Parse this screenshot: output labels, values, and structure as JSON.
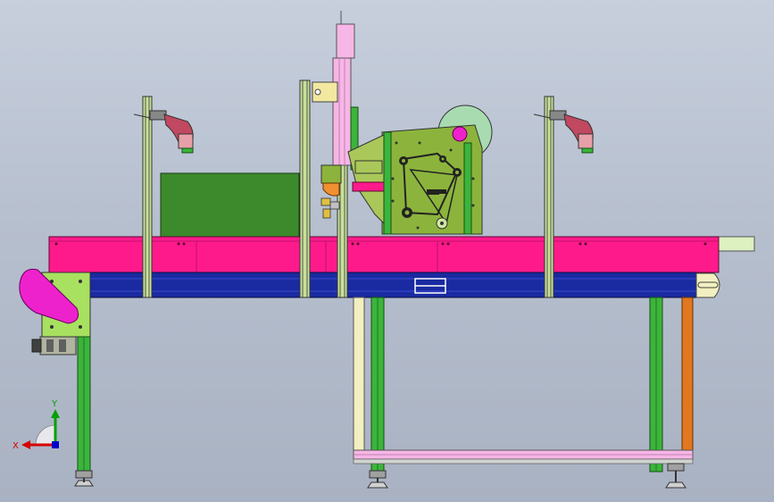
{
  "view": {
    "background_top": "#c7cfdd",
    "background_bottom": "#a9b2c2"
  },
  "triad": {
    "x_label": "X",
    "y_label": "Y",
    "x_color": "#d40000",
    "y_color": "#00a000",
    "z_color": "#0000c8"
  },
  "colors": {
    "conveyor_top": "#ff1a8c",
    "conveyor_belt": "#1a2aa0",
    "legs_green": "#3cb43c",
    "frame_pink": "#f6b6e6",
    "leg_orange": "#e07820",
    "leg_cream": "#f2f0c0",
    "machine_olive": "#8cb43c",
    "green_box": "#3c8a2c",
    "motor_magenta": "#ee22cc",
    "uprights": "#c8e09a"
  }
}
